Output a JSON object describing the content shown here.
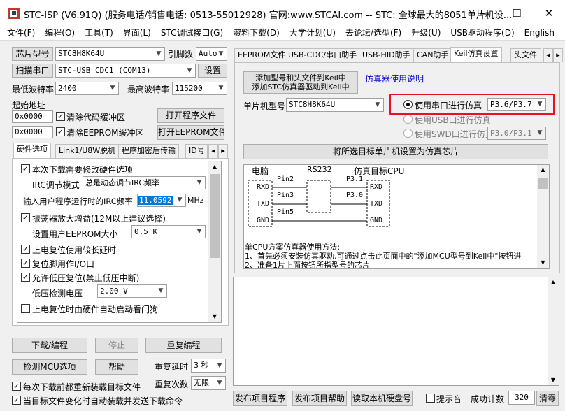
{
  "window": {
    "title": "STC-ISP (V6.91Q) (服务电话/销售电话: 0513-55012928) 官网:www.STCAI.com  -- STC: 全球最大的8051单片机设...",
    "minimize": "—",
    "maximize": "☐",
    "close": "✕"
  },
  "menu": [
    "文件(F)",
    "编程(O)",
    "工具(T)",
    "界面(L)",
    "STC调试接口(G)",
    "资料下载(D)",
    "大学计划(U)",
    "去论坛/选型(F)",
    "升级(U)",
    "USB驱动程序(D)",
    "English"
  ],
  "left": {
    "chip_btn": "芯片型号",
    "chip_value": "STC8H8K64U",
    "pin_label": "引脚数",
    "pin_value": "Auto",
    "scan_btn": "扫描串口",
    "port_value": "STC-USB CDC1 (COM13)",
    "settings_btn": "设置",
    "min_baud_label": "最低波特率",
    "min_baud": "2400",
    "max_baud_label": "最高波特率",
    "max_baud": "115200",
    "start_addr_label": "起始地址",
    "addr1": "0x0000",
    "clear_code": "清除代码缓冲区",
    "open_prog": "打开程序文件",
    "addr2": "0x0000",
    "clear_eeprom": "清除EEPROM缓冲区",
    "open_eeprom": "打开EEPROM文件",
    "tabs": [
      "硬件选项",
      "Link1/U8W脱机",
      "程序加密后传输",
      "ID号"
    ],
    "hw": {
      "opt1": "本次下载需要修改硬件选项",
      "irc_mode_label": "IRC调节模式",
      "irc_mode": "总是动态调节IRC频率",
      "irc_freq_label": "输入用户程序运行时的IRC频率",
      "irc_freq": "11.0592",
      "mhz": "MHz",
      "osc_gain": "振荡器放大增益(12M以上建议选择)",
      "eeprom_size_label": "设置用户EEPROM大小",
      "eeprom_size": "0.5 K",
      "power_delay": "上电复位使用较长延时",
      "reset_pin": "复位脚用作I/O口",
      "lvd_reset": "允许低压复位(禁止低压中断)",
      "lvd_label": "低压检测电压",
      "lvd_value": "2.00 V",
      "watchdog": "上电复位时由硬件自动启动看门狗"
    },
    "download_btn": "下载/编程",
    "stop_btn": "停止",
    "reprogram_btn": "重复编程",
    "detect_btn": "检测MCU选项",
    "help_btn": "帮助",
    "repeat_delay_label": "重复延时",
    "repeat_delay": "3 秒",
    "repeat_count_label": "重复次数",
    "repeat_count": "无限",
    "reload_before": "每次下载前都重新装载目标文件",
    "auto_reload": "当目标文件变化时自动装载并发送下载命令"
  },
  "right": {
    "tabs": [
      "EEPROM文件",
      "USB-CDC/串口助手",
      "USB-HID助手",
      "CAN助手",
      "Keil仿真设置",
      "头文件"
    ],
    "add_keil_btn1": "添加型号和头文件到Keil中",
    "add_keil_btn2": "添加STC仿真器驱动到Keil中",
    "emu_help_link": "仿真器使用说明",
    "mcu_label": "单片机型号",
    "mcu_value": "STC8H8K64U",
    "serial_emu": "使用串口进行仿真",
    "serial_port": "P3.6/P3.7",
    "usb_emu": "使用USB口进行仿真",
    "swd_emu": "使用SWD口进行仿真",
    "swd_port": "P3.0/P3.1",
    "set_chip_btn": "将所选目标单片机设置为仿真芯片",
    "diagram": {
      "pc": "电脑",
      "rs232": "RS232",
      "target": "仿真目标CPU",
      "rxd": "RXD",
      "txd": "TXD",
      "gnd": "GND",
      "pin2": "Pin2",
      "pin3": "Pin3",
      "pin5": "Pin5",
      "p31": "P3.1",
      "p30": "P3.0",
      "trxd": "RXD",
      "ttxd": "TXD",
      "tgnd": "GND"
    },
    "notes": [
      "单CPU方案仿真器使用方法:",
      "1、首先必须安装仿真驱动,可通过点击此页面中的\"添加MCU型号到Keil中\"按钮进",
      "2、准备1片上面按钮所指型号的芯片"
    ]
  },
  "bottom": {
    "publish_prog": "发布项目程序",
    "publish_help": "发布项目帮助",
    "read_disk": "读取本机硬盘号",
    "beep": "提示音",
    "success_label": "成功计数",
    "success_count": "320",
    "clear": "清零"
  },
  "colors": {
    "highlight": "#e81123",
    "link": "#0000cc",
    "freq_bg": "#0078d7"
  }
}
